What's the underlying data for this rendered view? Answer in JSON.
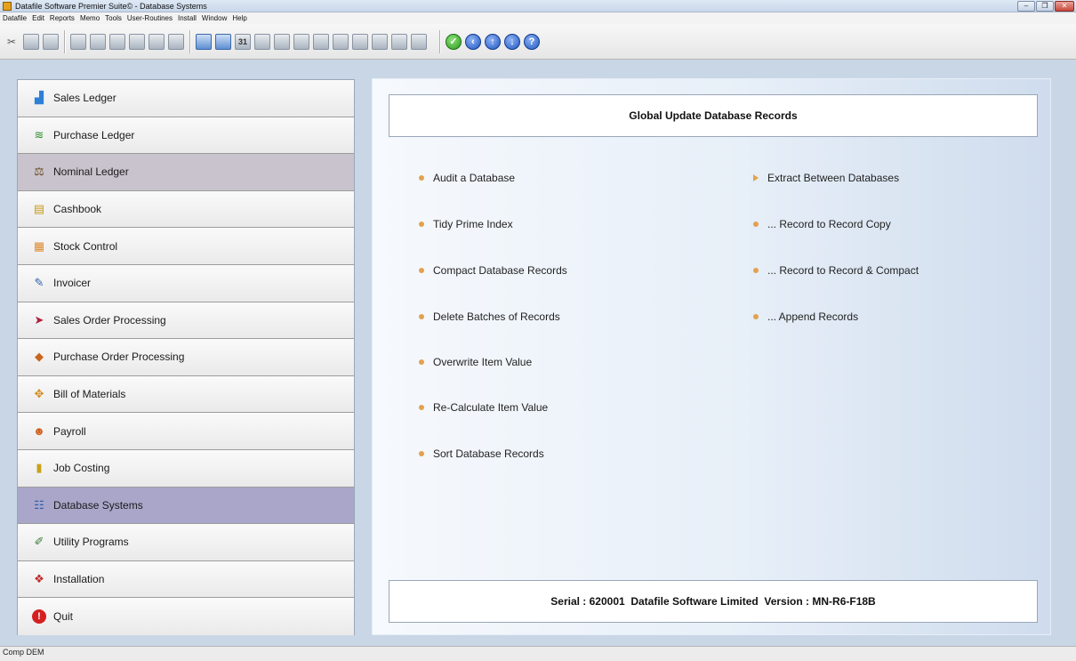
{
  "window": {
    "title": "Datafile Software Premier Suite© - Database Systems"
  },
  "menu": [
    "Datafile",
    "Edit",
    "Reports",
    "Memo",
    "Tools",
    "User-Routines",
    "Install",
    "Window",
    "Help"
  ],
  "toolbar": {
    "icons": [
      "cut-icon",
      "copy-icon",
      "paste-icon",
      "find-icon",
      "find-next-icon",
      "list-icon",
      "tools-icon",
      "print-preview-icon",
      "printer-icon",
      "report-icon",
      "calculator-icon",
      "calendar-icon",
      "notes-icon",
      "chart-icon",
      "home-icon",
      "mail-icon",
      "word-icon",
      "picture-icon",
      "database-icon",
      "transfer-icon",
      "form-icon"
    ],
    "nav_icons": [
      "ok-icon",
      "back-icon",
      "up-icon",
      "down-icon",
      "help-icon"
    ],
    "calendar_label": "31"
  },
  "nav": {
    "items": [
      {
        "label": "Sales Ledger",
        "icon": "chart-icon"
      },
      {
        "label": "Purchase Ledger",
        "icon": "money-icon"
      },
      {
        "label": "Nominal Ledger",
        "icon": "scales-icon"
      },
      {
        "label": "Cashbook",
        "icon": "cash-icon"
      },
      {
        "label": "Stock Control",
        "icon": "boxes-icon"
      },
      {
        "label": "Invoicer",
        "icon": "invoice-icon"
      },
      {
        "label": "Sales Order Processing",
        "icon": "order-icon"
      },
      {
        "label": "Purchase Order Processing",
        "icon": "package-icon"
      },
      {
        "label": "Bill of Materials",
        "icon": "materials-icon"
      },
      {
        "label": "Payroll",
        "icon": "people-icon"
      },
      {
        "label": "Job Costing",
        "icon": "folder-icon"
      },
      {
        "label": "Database Systems",
        "icon": "database-icon"
      },
      {
        "label": "Utility Programs",
        "icon": "utility-icon"
      },
      {
        "label": "Installation",
        "icon": "install-icon"
      },
      {
        "label": "Quit",
        "icon": "quit-icon"
      }
    ]
  },
  "main": {
    "heading": "Global Update Database Records",
    "left_options": [
      "Audit a Database",
      "Tidy Prime Index",
      "Compact Database Records",
      "Delete Batches of Records",
      "Overwrite Item Value",
      "Re-Calculate Item Value",
      "Sort Database Records"
    ],
    "right_options": [
      "Extract Between Databases",
      "... Record to Record Copy",
      "... Record to Record & Compact",
      "... Append Records"
    ],
    "footer": "Serial : 620001  Datafile Software Limited  Version : MN-R6-F18B"
  },
  "status": {
    "text": "Comp DEM"
  },
  "colors": {
    "nav_active": "#a9a6c9",
    "nav_hover": "#c9c3cd",
    "bullet": "#e3a14d",
    "background": "#c9d6e6"
  }
}
